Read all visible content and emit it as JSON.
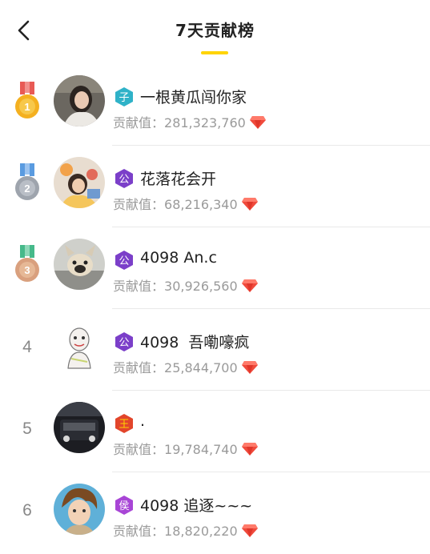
{
  "header": {
    "title": "7天贡献榜"
  },
  "contrib_label": "贡献值：",
  "colors": {
    "accent": "#ffd400",
    "gem": "#f04a3c"
  },
  "rows": [
    {
      "rank": "1",
      "badge": "子",
      "badge_color": "#2fb2c8",
      "name": "一根黄瓜闯你家",
      "value": "281,323,760"
    },
    {
      "rank": "2",
      "badge": "公",
      "badge_color": "#7b3fc9",
      "name": "花落花会开",
      "value": "68,216,340"
    },
    {
      "rank": "3",
      "badge": "公",
      "badge_color": "#7b3fc9",
      "name": "4098 An.c",
      "value": "30,926,560"
    },
    {
      "rank": "4",
      "badge": "公",
      "badge_color": "#7b3fc9",
      "name": "4098  吾嘞嚎疯",
      "value": "25,844,700"
    },
    {
      "rank": "5",
      "badge": "王",
      "badge_color": "#e2452b",
      "name": ".",
      "value": "19,784,740"
    },
    {
      "rank": "6",
      "badge": "侯",
      "badge_color": "#a845d6",
      "name": "4098 追逐~~~",
      "value": "18,820,220"
    }
  ]
}
